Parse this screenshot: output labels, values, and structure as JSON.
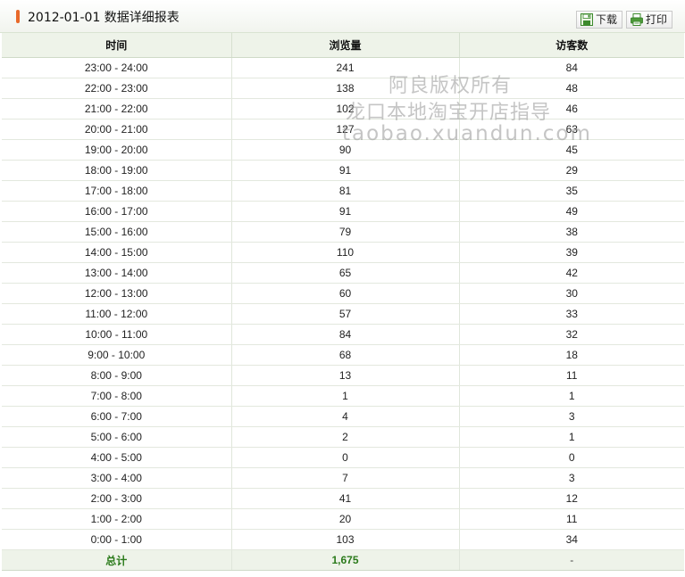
{
  "header": {
    "title": "2012-01-01 数据详细报表",
    "download_label": "下载",
    "print_label": "打印"
  },
  "table": {
    "columns": [
      "时间",
      "浏览量",
      "访客数"
    ],
    "rows": [
      [
        "23:00 - 24:00",
        "241",
        "84"
      ],
      [
        "22:00 - 23:00",
        "138",
        "48"
      ],
      [
        "21:00 - 22:00",
        "102",
        "46"
      ],
      [
        "20:00 - 21:00",
        "127",
        "63"
      ],
      [
        "19:00 - 20:00",
        "90",
        "45"
      ],
      [
        "18:00 - 19:00",
        "91",
        "29"
      ],
      [
        "17:00 - 18:00",
        "81",
        "35"
      ],
      [
        "16:00 - 17:00",
        "91",
        "49"
      ],
      [
        "15:00 - 16:00",
        "79",
        "38"
      ],
      [
        "14:00 - 15:00",
        "110",
        "39"
      ],
      [
        "13:00 - 14:00",
        "65",
        "42"
      ],
      [
        "12:00 - 13:00",
        "60",
        "30"
      ],
      [
        "11:00 - 12:00",
        "57",
        "33"
      ],
      [
        "10:00 - 11:00",
        "84",
        "32"
      ],
      [
        "9:00 - 10:00",
        "68",
        "18"
      ],
      [
        "8:00 - 9:00",
        "13",
        "11"
      ],
      [
        "7:00 - 8:00",
        "1",
        "1"
      ],
      [
        "6:00 - 7:00",
        "4",
        "3"
      ],
      [
        "5:00 - 6:00",
        "2",
        "1"
      ],
      [
        "4:00 - 5:00",
        "0",
        "0"
      ],
      [
        "3:00 - 4:00",
        "7",
        "3"
      ],
      [
        "2:00 - 3:00",
        "41",
        "12"
      ],
      [
        "1:00 - 2:00",
        "20",
        "11"
      ],
      [
        "0:00 - 1:00",
        "103",
        "34"
      ]
    ],
    "total": {
      "label": "总计",
      "pageviews": "1,675",
      "visitors": "-"
    }
  },
  "watermark": {
    "line1": "阿良版权所有",
    "line2": "龙口本地淘宝开店指导",
    "line3": "taobao.xuandun.com"
  },
  "colors": {
    "accent_mark": "#e8692a",
    "header_bg": "#eef3e9",
    "total_text": "#2a7a1a"
  }
}
